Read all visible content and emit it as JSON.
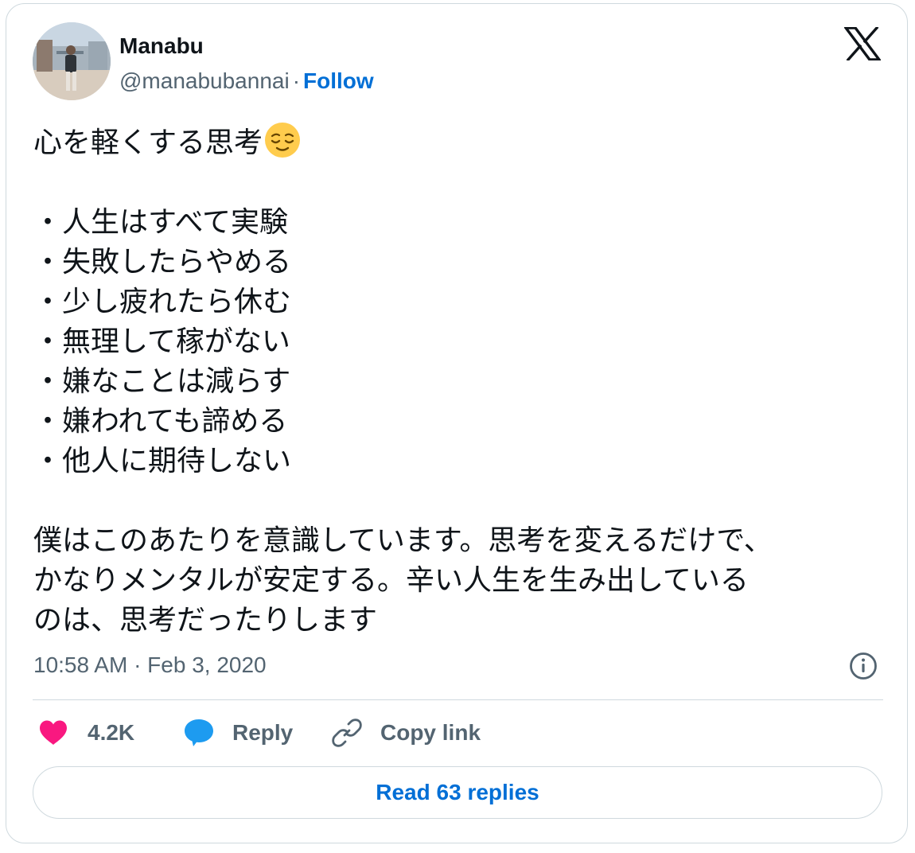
{
  "author": {
    "name": "Manabu",
    "handle": "@manabubannai",
    "separator": "·",
    "follow_label": "Follow"
  },
  "tweet": {
    "title_line": "心を軽くする思考",
    "title_emoji": "relieved-face-emoji",
    "bullets": [
      "・人生はすべて実験",
      "・失敗したらやめる",
      "・少し疲れたら休む",
      "・無理して稼がない",
      "・嫌なことは減らす",
      "・嫌われても諦める",
      "・他人に期待しない"
    ],
    "body": "僕はこのあたりを意識しています。思考を変えるだけで、\nかなりメンタルが安定する。辛い人生を生み出している\nのは、思考だったりします"
  },
  "timestamp": "10:58 AM · Feb 3, 2020",
  "actions": {
    "like_count": "4.2K",
    "reply_label": "Reply",
    "copy_label": "Copy link"
  },
  "read_replies_label": "Read 63 replies",
  "colors": {
    "text": "#0f1419",
    "secondary": "#536471",
    "link": "#006fd6",
    "like": "#f91880",
    "reply": "#1d9bf0",
    "border": "#cfd9de"
  },
  "icons": {
    "brand": "x-logo-icon",
    "info": "info-icon",
    "like": "heart-icon",
    "reply": "speech-bubble-icon",
    "copy": "link-icon"
  }
}
